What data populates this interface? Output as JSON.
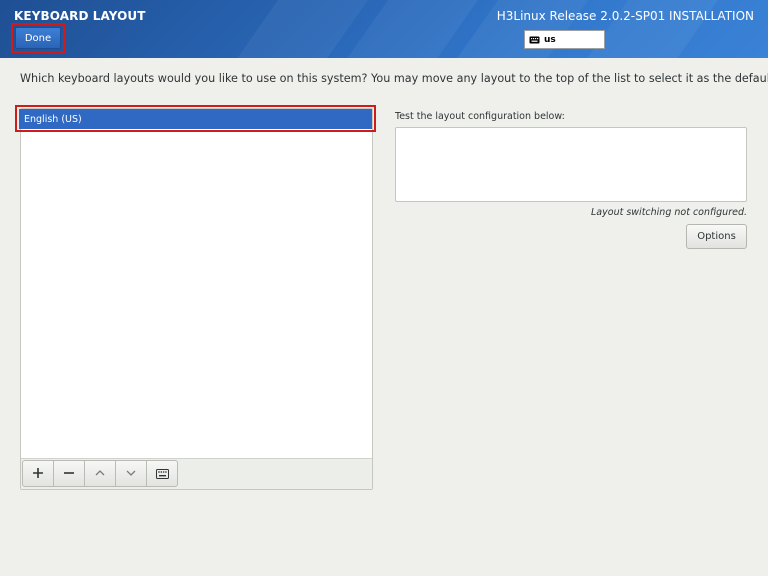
{
  "header": {
    "title": "KEYBOARD LAYOUT",
    "done_label": "Done",
    "release": "H3Linux Release 2.0.2-SP01 INSTALLATION",
    "keyboard_indicator": "us",
    "keyboard_icon": "keyboard-icon",
    "colors": {
      "bar_start": "#1f4f93",
      "bar_end": "#3a82d6",
      "highlight": "#d11a1a"
    }
  },
  "main": {
    "instructions": "Which keyboard layouts would you like to use on this system?  You may move any layout to the top of the list to select it as the default.",
    "layouts": [
      {
        "label": "English (US)",
        "selected": true
      }
    ],
    "toolbar": {
      "add_icon": "plus-icon",
      "remove_icon": "minus-icon",
      "move_up_icon": "chevron-up-icon",
      "move_down_icon": "chevron-down-icon",
      "preview_icon": "keyboard-icon"
    },
    "test_label": "Test the layout configuration below:",
    "test_value": "",
    "switching_status": "Layout switching not configured.",
    "options_label": "Options",
    "colors": {
      "selection": "#2f69c4",
      "background": "#eff0ec"
    }
  }
}
